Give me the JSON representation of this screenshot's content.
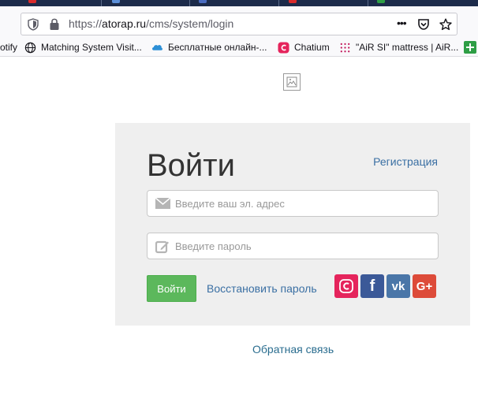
{
  "browser": {
    "url_prefix": "https://",
    "url_host": "atorap.ru",
    "url_path": "/cms/system/login",
    "more_label": "•••"
  },
  "bookmarks": [
    {
      "label": "otify"
    },
    {
      "label": "Matching System Visit..."
    },
    {
      "label": "Бесплатные онлайн-..."
    },
    {
      "label": "Chatium"
    },
    {
      "label": "\"AiR SI\" mattress | AiR..."
    }
  ],
  "login": {
    "title": "Войти",
    "register_link": "Регистрация",
    "email_placeholder": "Введите ваш эл. адрес",
    "password_placeholder": "Введите пароль",
    "submit_label": "Войти",
    "restore_link": "Восстановить пароль",
    "social": [
      {
        "name": "chatium",
        "color": "#e5245c"
      },
      {
        "name": "facebook",
        "color": "#3b5998",
        "glyph": "f"
      },
      {
        "name": "vk",
        "color": "#4a76a8",
        "glyph": "vk"
      },
      {
        "name": "google-plus",
        "color": "#dd4b39",
        "glyph": "G+"
      }
    ]
  },
  "footer": {
    "feedback_link": "Обратная связь"
  },
  "colors": {
    "accent_link": "#3a6fa3",
    "button_green": "#5cb85c",
    "panel_bg": "#efefef"
  }
}
